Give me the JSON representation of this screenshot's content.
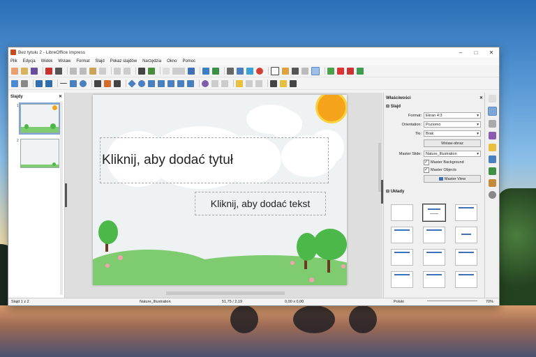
{
  "window": {
    "title": "Bez tytułu 2 - LibreOffice Impress"
  },
  "menu": [
    "Plik",
    "Edycja",
    "Widok",
    "Wstaw",
    "Format",
    "Slajd",
    "Pokaz slajdów",
    "Narzędzia",
    "Okno",
    "Pomoc"
  ],
  "slides_pane": {
    "title": "Slajdy",
    "thumbs": [
      {
        "num": "1"
      },
      {
        "num": "2"
      }
    ]
  },
  "slide": {
    "title_placeholder": "Kliknij, aby dodać tytuł",
    "text_placeholder": "Kliknij, aby dodać tekst"
  },
  "sidebar": {
    "title": "Właściwości",
    "section_slide": "Slajd",
    "format_label": "Format:",
    "format_value": "Ekran 4:3",
    "orientation_label": "Orientation:",
    "orientation_value": "Poziomo",
    "background_label": "Tło:",
    "background_value": "Brak",
    "insert_image_button": "Wstaw obraz",
    "master_label": "Master Slide:",
    "master_value": "Nature_Illustration",
    "master_background": "Master Background",
    "master_objects": "Master Objects",
    "master_view_button": "Master View",
    "section_layouts": "Układy"
  },
  "status": {
    "slide_info": "Slajd 1 z 2",
    "master": "Nature_Illustration",
    "position": "51,75 / 2,19",
    "size": "0,00 x 0,00",
    "language": "Polski",
    "zoom": "70%"
  },
  "colors": {
    "accent": "#7ea7d8",
    "sun": "#f5a31a",
    "grass": "#7fcb6f",
    "tree": "#4cb84a"
  }
}
